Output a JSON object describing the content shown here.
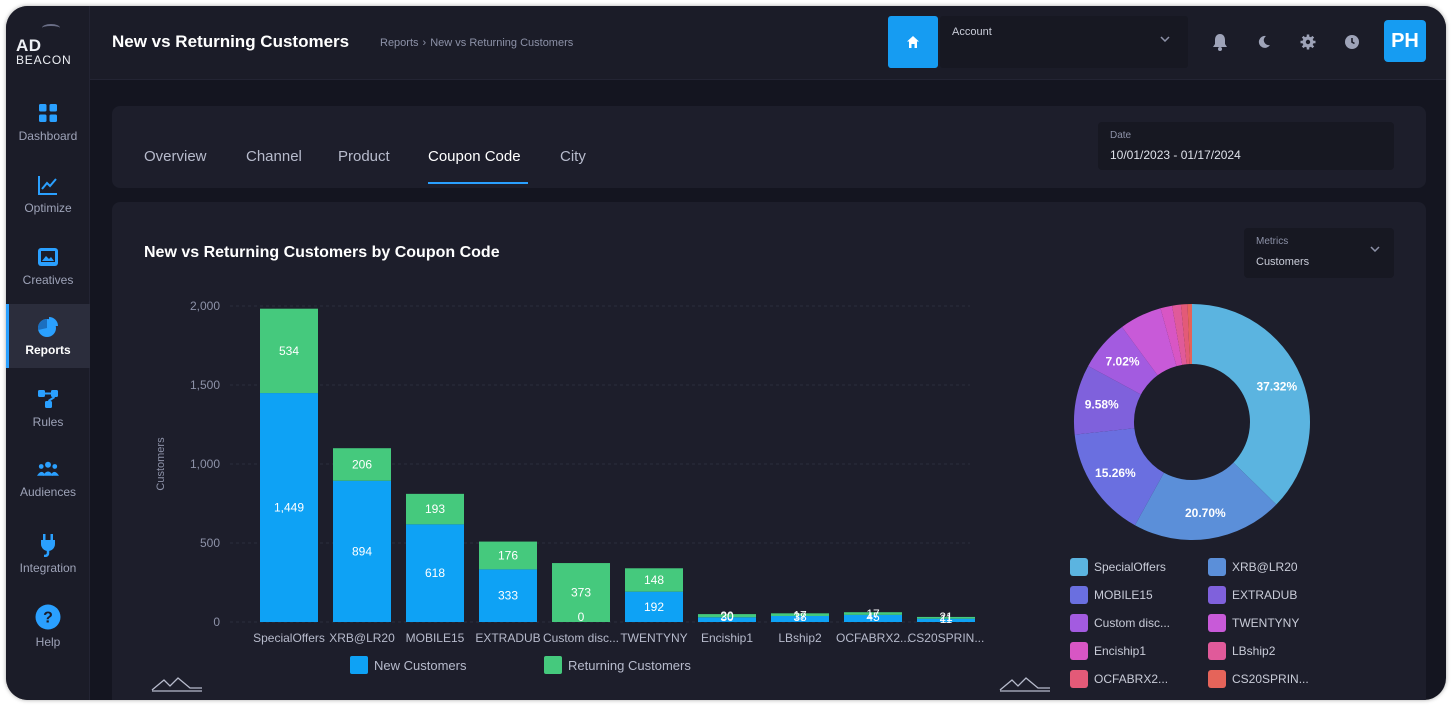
{
  "app": {
    "logo_line1": "AD",
    "logo_line2": "BEACON",
    "page_title": "New vs Returning Customers",
    "breadcrumb": [
      "Reports",
      "New vs Returning Customers"
    ],
    "account_label": "Account",
    "avatar_initials": "PH",
    "accent_color": "#169cf2"
  },
  "sidebar": {
    "items": [
      {
        "label": "Dashboard",
        "icon": "grid-icon",
        "active": false
      },
      {
        "label": "Optimize",
        "icon": "line-chart-icon",
        "active": false
      },
      {
        "label": "Creatives",
        "icon": "image-icon",
        "active": false
      },
      {
        "label": "Reports",
        "icon": "pie-chart-icon",
        "active": true
      },
      {
        "label": "Rules",
        "icon": "flow-icon",
        "active": false
      },
      {
        "label": "Audiences",
        "icon": "people-icon",
        "active": false
      },
      {
        "label": "Integration",
        "icon": "plug-icon",
        "active": false
      },
      {
        "label": "Help",
        "icon": "help-icon",
        "active": false
      }
    ]
  },
  "header_icons": [
    "bell-icon",
    "moon-icon",
    "gear-icon",
    "clock-icon"
  ],
  "tabs": [
    {
      "label": "Overview",
      "active": false
    },
    {
      "label": "Channel",
      "active": false
    },
    {
      "label": "Product",
      "active": false
    },
    {
      "label": "Coupon Code",
      "active": true
    },
    {
      "label": "City",
      "active": false
    }
  ],
  "date_filter": {
    "label": "Date",
    "value": "10/01/2023 - 01/17/2024"
  },
  "metrics_select": {
    "label": "Metrics",
    "value": "Customers"
  },
  "chart_title": "New vs Returning Customers by Coupon Code",
  "chart_data": [
    {
      "type": "bar",
      "stacked": true,
      "title": "New vs Returning Customers by Coupon Code",
      "xlabel": "",
      "ylabel": "Customers",
      "ylim": [
        0,
        2000
      ],
      "yticks": [
        "0",
        "500",
        "1,000",
        "1,500",
        "2,000"
      ],
      "grid": true,
      "legend_position": "bottom",
      "categories": [
        "SpecialOffers",
        "XRB@LR20",
        "MOBILE15",
        "EXTRADUB",
        "Custom disc...",
        "TWENTYNY",
        "Enciship1",
        "LBship2",
        "OCFABRX2...",
        "CS20SPRIN..."
      ],
      "series": [
        {
          "name": "New Customers",
          "color": "#0ea2f5",
          "values": [
            1449,
            894,
            618,
            333,
            0,
            192,
            30,
            38,
            45,
            21
          ],
          "labels": [
            "1,449",
            "894",
            "618",
            "333",
            "0",
            "192",
            "30",
            "38",
            "45",
            "21"
          ]
        },
        {
          "name": "Returning Customers",
          "color": "#45c97d",
          "values": [
            534,
            206,
            193,
            176,
            373,
            148,
            20,
            17,
            17,
            11
          ],
          "labels": [
            "534",
            "206",
            "193",
            "176",
            "373",
            "148",
            "20",
            "17",
            "17",
            "11"
          ]
        }
      ]
    },
    {
      "type": "pie",
      "donut": true,
      "legend_position": "bottom",
      "slices": [
        {
          "label": "SpecialOffers",
          "value": 37.32,
          "color": "#5bb4e0",
          "text": "37.32%"
        },
        {
          "label": "XRB@LR20",
          "value": 20.7,
          "color": "#5b8fd9",
          "text": "20.70%"
        },
        {
          "label": "MOBILE15",
          "value": 15.26,
          "color": "#6a6fe0",
          "text": "15.26%"
        },
        {
          "label": "EXTRADUB",
          "value": 9.58,
          "color": "#7f61dc",
          "text": "9.58%"
        },
        {
          "label": "Custom disc...",
          "value": 7.02,
          "color": "#a35be0",
          "text": "7.02%"
        },
        {
          "label": "TWENTYNY",
          "value": 5.8,
          "color": "#c85ad8",
          "text": ""
        },
        {
          "label": "Enciship1",
          "value": 1.6,
          "color": "#d856c4",
          "text": ""
        },
        {
          "label": "LBship2",
          "value": 1.2,
          "color": "#e05a9a",
          "text": ""
        },
        {
          "label": "OCFABRX2...",
          "value": 0.9,
          "color": "#e35a78",
          "text": ""
        },
        {
          "label": "CS20SPRIN...",
          "value": 0.6,
          "color": "#e5645a",
          "text": ""
        }
      ]
    }
  ]
}
